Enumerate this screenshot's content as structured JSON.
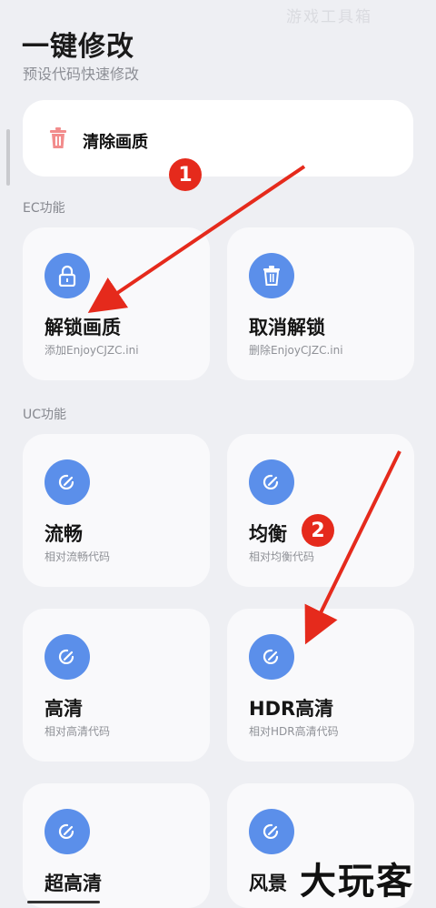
{
  "header": {
    "title": "一键修改",
    "subtitle": "预设代码快速修改",
    "watermark_top": "游戏工具箱"
  },
  "clear_card": {
    "label": "清除画质",
    "icon": "trash-icon",
    "icon_color": "#f28c8c"
  },
  "sections": {
    "ec": "EC功能",
    "uc": "UC功能"
  },
  "ec_cards": [
    {
      "title": "解锁画质",
      "desc": "添加EnjoyCJZC.ini",
      "icon": "lock-icon"
    },
    {
      "title": "取消解锁",
      "desc": "删除EnjoyCJZC.ini",
      "icon": "trash-icon"
    }
  ],
  "uc_cards": [
    {
      "title": "流畅",
      "desc": "相对流畅代码",
      "icon": "edit-icon"
    },
    {
      "title": "均衡",
      "desc": "相对均衡代码",
      "icon": "edit-icon"
    },
    {
      "title": "高清",
      "desc": "相对高清代码",
      "icon": "edit-icon"
    },
    {
      "title": "HDR高清",
      "desc": "相对HDR高清代码",
      "icon": "edit-icon"
    },
    {
      "title": "超高清",
      "desc": "",
      "icon": "edit-icon"
    },
    {
      "title": "风景",
      "desc": "",
      "icon": "edit-icon"
    }
  ],
  "annotations": {
    "badge_1": "1",
    "badge_2": "2"
  },
  "watermark_logo": "大玩客",
  "colors": {
    "accent": "#5b8fea",
    "annotation_red": "#e52a1c",
    "background": "#eeeff3"
  }
}
